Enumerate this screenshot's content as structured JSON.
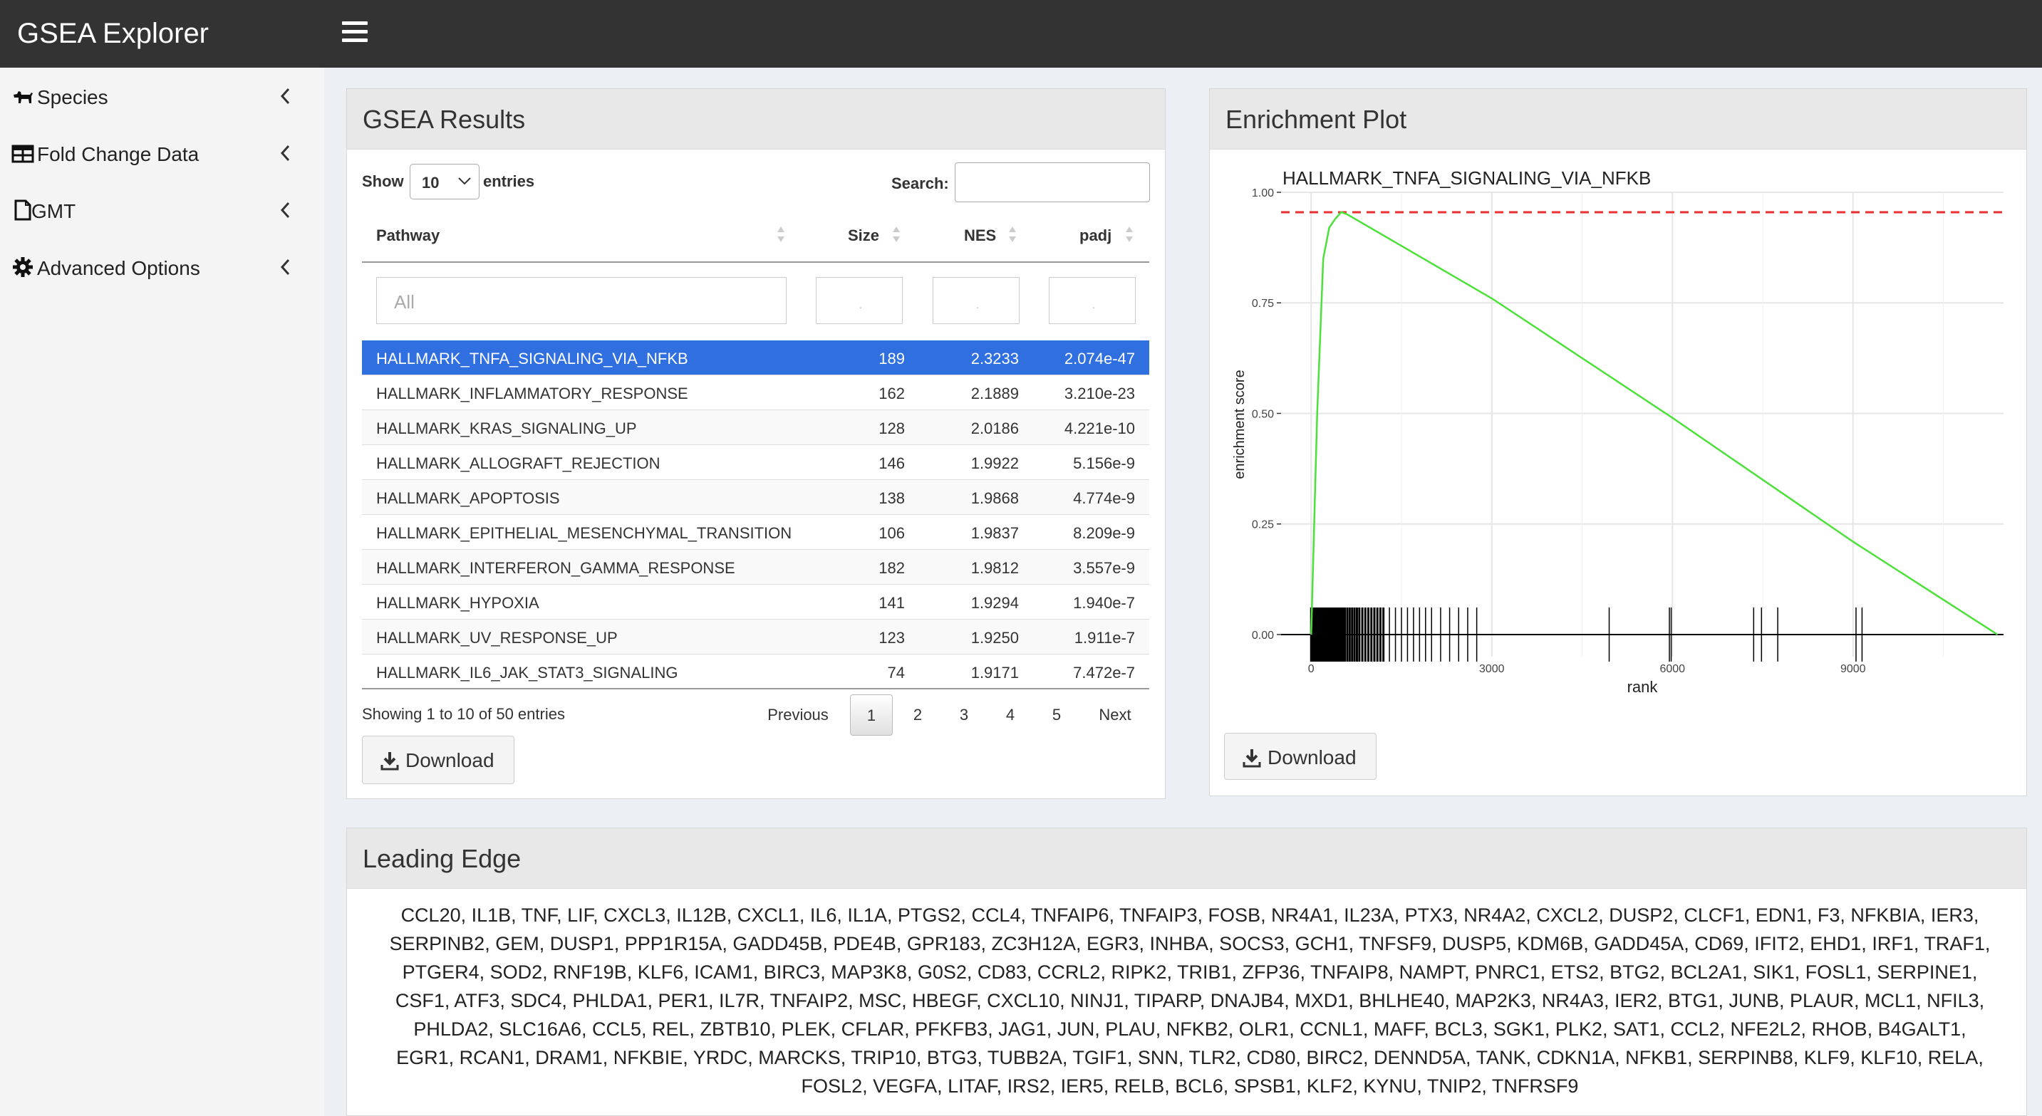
{
  "app": {
    "title": "GSEA Explorer"
  },
  "sidebar": {
    "items": [
      {
        "label": "Species",
        "icon": "dog-icon"
      },
      {
        "label": "Fold Change Data",
        "icon": "table-icon"
      },
      {
        "label": "GMT",
        "icon": "file-icon"
      },
      {
        "label": "Advanced Options",
        "icon": "gear-icon"
      }
    ]
  },
  "results": {
    "title": "GSEA Results",
    "show_label": "Show",
    "entries_label": "entries",
    "page_length": "10",
    "search_label": "Search:",
    "search_value": "",
    "columns": [
      "Pathway",
      "Size",
      "NES",
      "padj"
    ],
    "filter_placeholder": "All",
    "rows": [
      [
        "HALLMARK_TNFA_SIGNALING_VIA_NFKB",
        "189",
        "2.3233",
        "2.074e-47"
      ],
      [
        "HALLMARK_INFLAMMATORY_RESPONSE",
        "162",
        "2.1889",
        "3.210e-23"
      ],
      [
        "HALLMARK_KRAS_SIGNALING_UP",
        "128",
        "2.0186",
        "4.221e-10"
      ],
      [
        "HALLMARK_ALLOGRAFT_REJECTION",
        "146",
        "1.9922",
        "5.156e-9"
      ],
      [
        "HALLMARK_APOPTOSIS",
        "138",
        "1.9868",
        "4.774e-9"
      ],
      [
        "HALLMARK_EPITHELIAL_MESENCHYMAL_TRANSITION",
        "106",
        "1.9837",
        "8.209e-9"
      ],
      [
        "HALLMARK_INTERFERON_GAMMA_RESPONSE",
        "182",
        "1.9812",
        "3.557e-9"
      ],
      [
        "HALLMARK_HYPOXIA",
        "141",
        "1.9294",
        "1.940e-7"
      ],
      [
        "HALLMARK_UV_RESPONSE_UP",
        "123",
        "1.9250",
        "1.911e-7"
      ],
      [
        "HALLMARK_IL6_JAK_STAT3_SIGNALING",
        "74",
        "1.9171",
        "7.472e-7"
      ]
    ],
    "info": "Showing 1 to 10 of 50 entries",
    "pagination": {
      "previous": "Previous",
      "pages": [
        "1",
        "2",
        "3",
        "4",
        "5"
      ],
      "current": "1",
      "next": "Next"
    },
    "download_label": "Download"
  },
  "plot": {
    "title": "Enrichment Plot",
    "download_label": "Download"
  },
  "chart_data": {
    "type": "line",
    "title": "HALLMARK_TNFA_SIGNALING_VIA_NFKB",
    "xlabel": "rank",
    "ylabel": "enrichment score",
    "xlim": [
      -600,
      9900
    ],
    "ylim": [
      -0.05,
      1.0
    ],
    "x_ticks": [
      0,
      3000,
      6000,
      9000
    ],
    "y_ticks": [
      "0.00",
      "0.25",
      "0.50",
      "0.75",
      "1.00"
    ],
    "y_tick_values": [
      0,
      0.25,
      0.5,
      0.75,
      1.0
    ],
    "grid": true,
    "threshold": 0.955,
    "series": [
      {
        "color": "#4de03a",
        "points": [
          [
            0,
            0
          ],
          [
            100,
            0.5
          ],
          [
            200,
            0.85
          ],
          [
            300,
            0.92
          ],
          [
            400,
            0.94
          ],
          [
            500,
            0.955
          ],
          [
            600,
            0.95
          ],
          [
            3000,
            0.76
          ],
          [
            6000,
            0.49
          ],
          [
            9000,
            0.21
          ],
          [
            11400,
            0.0
          ]
        ]
      }
    ],
    "ticks": [
      0,
      20,
      40,
      60,
      80,
      100,
      120,
      140,
      160,
      180,
      200,
      220,
      240,
      260,
      280,
      300,
      320,
      340,
      360,
      380,
      400,
      420,
      440,
      460,
      480,
      500,
      530,
      560,
      600,
      640,
      680,
      720,
      760,
      800,
      850,
      900,
      950,
      1000,
      1050,
      1100,
      1150,
      1200,
      1300,
      1400,
      1500,
      1600,
      1700,
      1800,
      1900,
      2000,
      2150,
      2300,
      2450,
      2600,
      2750,
      4950,
      5950,
      5980,
      7350,
      7480,
      7750,
      9050,
      9150
    ],
    "colors": {
      "line": "#4de03a",
      "threshold": "#e83030",
      "ticks": "#000000"
    }
  },
  "leading_edge": {
    "title": "Leading Edge",
    "lines": [
      "CCL20, IL1B, TNF, LIF, CXCL3, IL12B, CXCL1, IL6, IL1A, PTGS2, CCL4, TNFAIP6, TNFAIP3, FOSB, NR4A1, IL23A, PTX3, NR4A2, CXCL2, DUSP2, CLCF1, EDN1, F3, NFKBIA, IER3,",
      "SERPINB2, GEM, DUSP1, PPP1R15A, GADD45B, PDE4B, GPR183, ZC3H12A, EGR3, INHBA, SOCS3, GCH1, TNFSF9, DUSP5, KDM6B, GADD45A, CD69, IFIT2, EHD1, IRF1, TRAF1,",
      "PTGER4, SOD2, RNF19B, KLF6, ICAM1, BIRC3, MAP3K8, G0S2, CD83, CCRL2, RIPK2, TRIB1, ZFP36, TNFAIP8, NAMPT, PNRC1, ETS2, BTG2, BCL2A1, SIK1, FOSL1, SERPINE1,",
      "CSF1, ATF3, SDC4, PHLDA1, PER1, IL7R, TNFAIP2, MSC, HBEGF, CXCL10, NINJ1, TIPARP, DNAJB4, MXD1, BHLHE40, MAP2K3, NR4A3, IER2, BTG1, JUNB, PLAUR, MCL1, NFIL3,",
      "PHLDA2, SLC16A6, CCL5, REL, ZBTB10, PLEK, CFLAR, PFKFB3, JAG1, JUN, PLAU, NFKB2, OLR1, CCNL1, MAFF, BCL3, SGK1, PLK2, SAT1, CCL2, NFE2L2, RHOB, B4GALT1,",
      "EGR1, RCAN1, DRAM1, NFKBIE, YRDC, MARCKS, TRIP10, BTG3, TUBB2A, TGIF1, SNN, TLR2, CD80, BIRC2, DENND5A, TANK, CDKN1A, NFKB1, SERPINB8, KLF9, KLF10, RELA,",
      "FOSL2, VEGFA, LITAF, IRS2, IER5, RELB, BCL6, SPSB1, KLF2, KYNU, TNIP2, TNFRSF9"
    ]
  }
}
